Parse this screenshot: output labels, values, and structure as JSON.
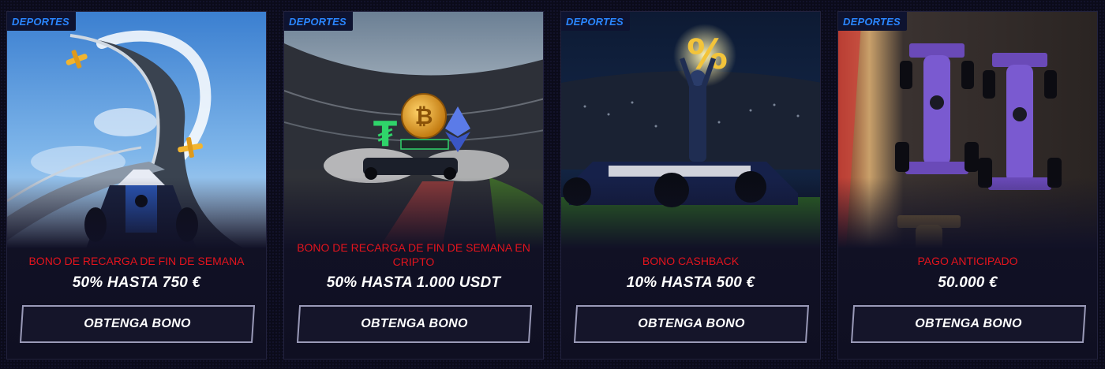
{
  "cards": [
    {
      "tag": "DEPORTES",
      "subtitle": "BONO DE RECARGA DE FIN DE SEMANA",
      "amount": "50% HASTA 750 €",
      "button_label": "OBTENGA BONO",
      "image": "plane-racetrack-illustration"
    },
    {
      "tag": "DEPORTES",
      "subtitle": "BONO DE RECARGA DE FIN DE SEMANA EN CRIPTO",
      "amount": "50% HASTA 1.000 USDT",
      "button_label": "OBTENGA BONO",
      "image": "crypto-stadium-illustration",
      "coin_symbols": [
        "₮",
        "₿",
        "Ξ"
      ]
    },
    {
      "tag": "DEPORTES",
      "subtitle": "BONO CASHBACK",
      "amount": "10% HASTA 500 €",
      "button_label": "OBTENGA BONO",
      "image": "driver-trophy-illustration",
      "trophy_symbol": "%"
    },
    {
      "tag": "DEPORTES",
      "subtitle": "PAGO ANTICIPADO",
      "amount": "50.000 €",
      "button_label": "OBTENGA BONO",
      "image": "racecars-topdown-illustration"
    }
  ],
  "colors": {
    "accent_red": "#e4141d",
    "tag_blue": "#2a86ff",
    "button_border": "#9a9ab8"
  }
}
